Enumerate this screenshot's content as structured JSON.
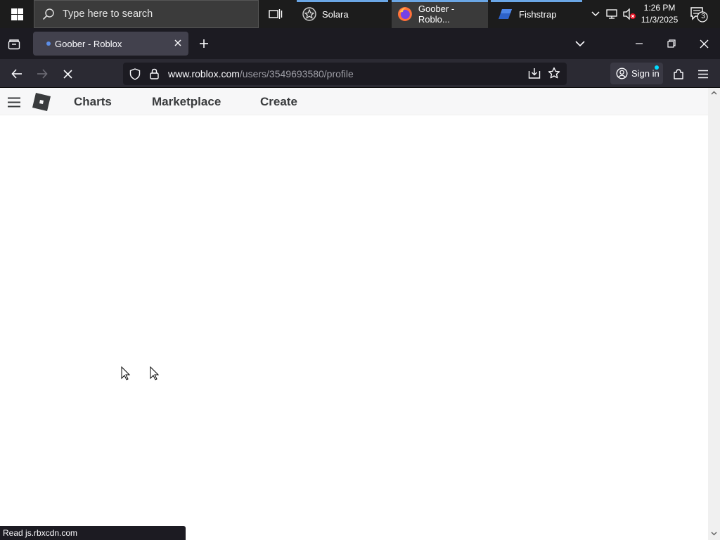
{
  "taskbar": {
    "search_placeholder": "Type here to search",
    "apps": [
      {
        "name": "Solara",
        "active": false
      },
      {
        "name": "Goober - Roblo...",
        "active": true
      },
      {
        "name": "Fishstrap",
        "active": false
      }
    ],
    "clock": {
      "time": "1:26 PM",
      "date": "11/3/2025"
    },
    "notification_count": "3"
  },
  "browser": {
    "tab": {
      "title": "Goober - Roblox"
    },
    "url": {
      "host": "www.roblox.com",
      "path": "/users/3549693580/profile"
    },
    "sign_in_label": "Sign in",
    "status_text": "Read js.rbxcdn.com"
  },
  "roblox": {
    "nav": [
      "Charts",
      "Marketplace",
      "Create"
    ]
  },
  "colors": {
    "taskbar_bg": "#1c1c1c",
    "firefox_toolbar": "#2b2a33",
    "firefox_tabstrip": "#1c1b22",
    "roblox_header": "#f7f7f8",
    "taskbar_accent": "#6aa6e5"
  },
  "icons": [
    "windows-logo-icon",
    "search-icon",
    "task-view-icon",
    "solara-icon",
    "firefox-icon",
    "fishstrap-icon",
    "chevron-up-icon",
    "network-icon",
    "volume-muted-icon",
    "notification-icon",
    "firefox-view-icon",
    "new-tab-icon",
    "list-all-tabs-icon",
    "minimize-icon",
    "restore-icon",
    "close-icon",
    "back-icon",
    "forward-icon",
    "stop-icon",
    "tracking-shield-icon",
    "lock-icon",
    "download-icon",
    "bookmark-star-icon",
    "account-icon",
    "extensions-icon",
    "menu-icon",
    "hamburger-icon",
    "roblox-logo-icon",
    "pointer-cursor-icon"
  ]
}
